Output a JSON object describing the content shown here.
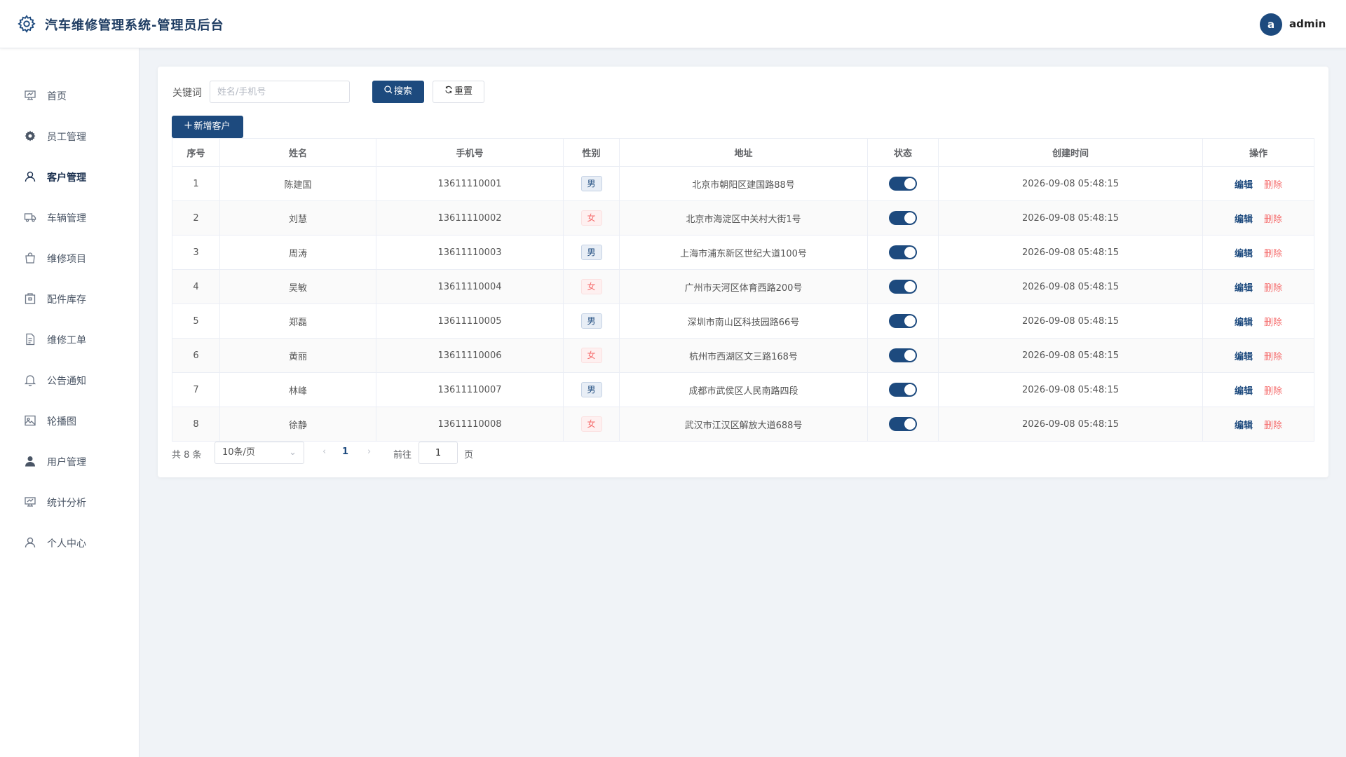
{
  "header": {
    "title": "汽车维修管理系统-管理员后台",
    "avatar_letter": "a",
    "username": "admin"
  },
  "sidebar": {
    "active_index": 2,
    "items": [
      {
        "label": "首页",
        "icon": "dashboard-icon"
      },
      {
        "label": "员工管理",
        "icon": "gear-icon"
      },
      {
        "label": "客户管理",
        "icon": "user-icon"
      },
      {
        "label": "车辆管理",
        "icon": "truck-icon"
      },
      {
        "label": "维修项目",
        "icon": "bag-icon"
      },
      {
        "label": "配件库存",
        "icon": "box-icon"
      },
      {
        "label": "维修工单",
        "icon": "document-icon"
      },
      {
        "label": "公告通知",
        "icon": "bell-icon"
      },
      {
        "label": "轮播图",
        "icon": "picture-icon"
      },
      {
        "label": "用户管理",
        "icon": "user-filled-icon"
      },
      {
        "label": "统计分析",
        "icon": "chart-board-icon"
      },
      {
        "label": "个人中心",
        "icon": "person-icon"
      }
    ]
  },
  "search": {
    "label": "关键词",
    "placeholder": "姓名/手机号",
    "value": "",
    "search_button": "搜索",
    "reset_button": "重置",
    "add_button": "新增客户"
  },
  "table": {
    "columns": [
      "序号",
      "姓名",
      "手机号",
      "性别",
      "地址",
      "状态",
      "创建时间",
      "操作"
    ],
    "edit_label": "编辑",
    "delete_label": "删除",
    "rows": [
      {
        "index": "1",
        "name": "陈建国",
        "phone": "13611110001",
        "gender": "男",
        "address": "北京市朝阳区建国路88号",
        "enabled": true,
        "created": "2026-09-08 05:48:15"
      },
      {
        "index": "2",
        "name": "刘慧",
        "phone": "13611110002",
        "gender": "女",
        "address": "北京市海淀区中关村大街1号",
        "enabled": true,
        "created": "2026-09-08 05:48:15"
      },
      {
        "index": "3",
        "name": "周涛",
        "phone": "13611110003",
        "gender": "男",
        "address": "上海市浦东新区世纪大道100号",
        "enabled": true,
        "created": "2026-09-08 05:48:15"
      },
      {
        "index": "4",
        "name": "吴敏",
        "phone": "13611110004",
        "gender": "女",
        "address": "广州市天河区体育西路200号",
        "enabled": true,
        "created": "2026-09-08 05:48:15"
      },
      {
        "index": "5",
        "name": "郑磊",
        "phone": "13611110005",
        "gender": "男",
        "address": "深圳市南山区科技园路66号",
        "enabled": true,
        "created": "2026-09-08 05:48:15"
      },
      {
        "index": "6",
        "name": "黄丽",
        "phone": "13611110006",
        "gender": "女",
        "address": "杭州市西湖区文三路168号",
        "enabled": true,
        "created": "2026-09-08 05:48:15"
      },
      {
        "index": "7",
        "name": "林峰",
        "phone": "13611110007",
        "gender": "男",
        "address": "成都市武侯区人民南路四段",
        "enabled": true,
        "created": "2026-09-08 05:48:15"
      },
      {
        "index": "8",
        "name": "徐静",
        "phone": "13611110008",
        "gender": "女",
        "address": "武汉市江汉区解放大道688号",
        "enabled": true,
        "created": "2026-09-08 05:48:15"
      }
    ]
  },
  "pagination": {
    "total_text": "共 8 条",
    "page_size": "10条/页",
    "current_page": "1",
    "goto_label": "前往",
    "goto_value": "1",
    "page_unit": "页"
  },
  "colors": {
    "primary": "#1d4a7e",
    "danger": "#f56c6c",
    "background": "#f0f3f7"
  }
}
